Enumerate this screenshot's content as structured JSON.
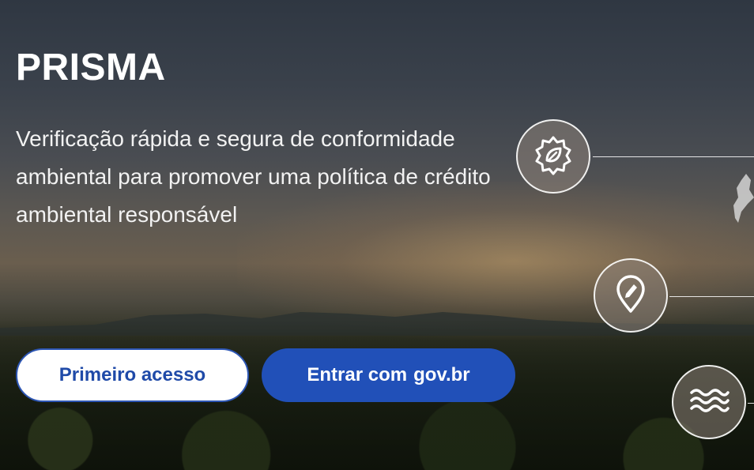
{
  "hero": {
    "title": "PRISMA",
    "tagline": "Verificação rápida e segura de conformidade ambiental para promover uma política de crédito ambiental responsável"
  },
  "buttons": {
    "first_access": "Primeiro acesso",
    "govbr_prefix": "Entrar com",
    "govbr_brand": "gov.br"
  },
  "features": [
    {
      "icon": "leaf-badge-icon"
    },
    {
      "icon": "map-pin-edit-icon"
    },
    {
      "icon": "water-waves-icon"
    }
  ],
  "colors": {
    "primary_blue": "#2150b8",
    "outline_blue": "#2d56b4",
    "text_white": "#ffffff"
  }
}
